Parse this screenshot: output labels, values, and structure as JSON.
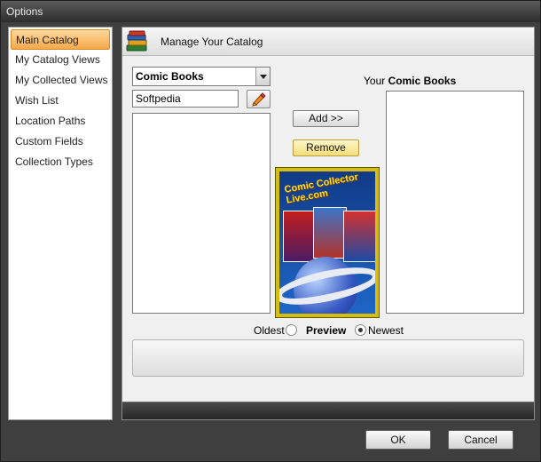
{
  "window": {
    "title": "Options"
  },
  "sidebar": {
    "items": [
      {
        "label": "Main Catalog",
        "active": true
      },
      {
        "label": "My Catalog Views"
      },
      {
        "label": "My Collected Views"
      },
      {
        "label": "Wish List"
      },
      {
        "label": "Location Paths"
      },
      {
        "label": "Custom Fields"
      },
      {
        "label": "Collection Types"
      }
    ]
  },
  "main": {
    "header_title": "Manage Your Catalog",
    "catalog_select": {
      "value": "Comic Books"
    },
    "search": {
      "value": "Softpedia"
    },
    "your_label_prefix": "Your",
    "your_label_bold": "Comic Books",
    "add_button": "Add >>",
    "remove_button": "Remove",
    "cover_title": "Comic Collector Live.com",
    "preview": {
      "oldest_label": "Oldest",
      "title": "Preview",
      "newest_label": "Newest",
      "selected": "Newest"
    }
  },
  "footer": {
    "ok": "OK",
    "cancel": "Cancel"
  },
  "colors": {
    "active_item": "#f5a94b",
    "title_bar": "#3a3a3a",
    "remove_button": "#f2dc79"
  },
  "icons": {
    "header": "books-stack-icon",
    "pencil": "pencil-edit-icon",
    "dropdown": "chevron-down-icon"
  }
}
